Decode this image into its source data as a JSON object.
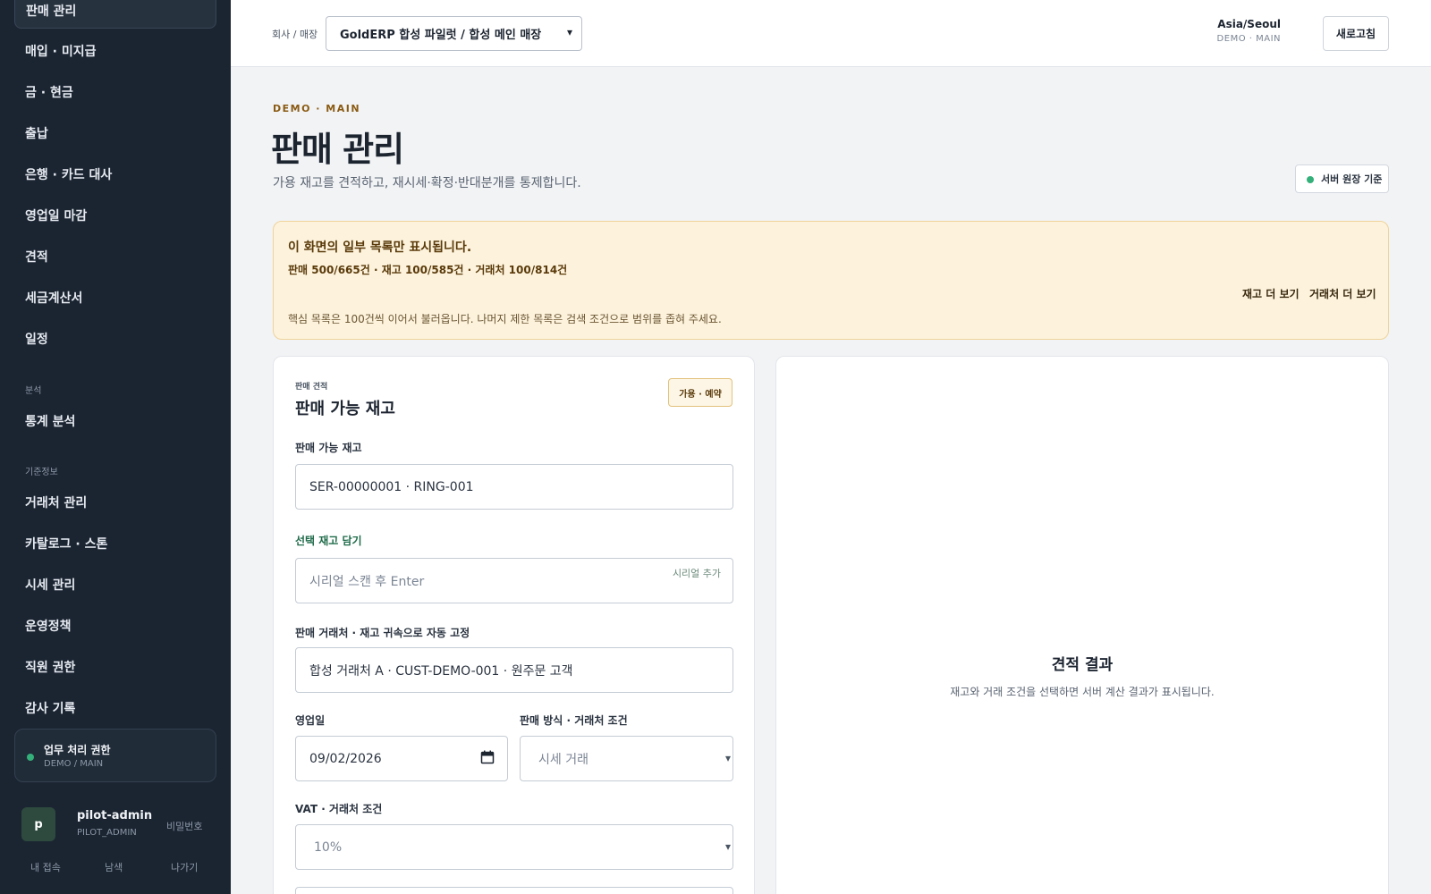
{
  "sidebar": {
    "items": [
      {
        "label": "판매 관리"
      },
      {
        "label": "매입 · 미지급"
      },
      {
        "label": "금 · 현금"
      },
      {
        "label": "출납"
      },
      {
        "label": "은행 · 카드 대사"
      },
      {
        "label": "영업일 마감"
      },
      {
        "label": "견적"
      },
      {
        "label": "세금계산서"
      },
      {
        "label": "일정"
      }
    ],
    "analysis_section": "분석",
    "analysis_items": [
      {
        "label": "통계 분석"
      }
    ],
    "master_section": "기준정보",
    "master_items": [
      {
        "label": "거래처 관리"
      },
      {
        "label": "카탈로그 · 스톤"
      },
      {
        "label": "시세 관리"
      },
      {
        "label": "운영정책"
      },
      {
        "label": "직원 권한"
      },
      {
        "label": "감사 기록"
      }
    ],
    "permission": {
      "title": "업무 처리 권한",
      "scope": "DEMO / MAIN"
    },
    "user": {
      "initial": "p",
      "name": "pilot-admin",
      "role": "PILOT_ADMIN",
      "password_link": "비밀번호"
    },
    "footer_links": [
      "내 접속",
      "남색",
      "나가기"
    ]
  },
  "topbar": {
    "company_label": "회사 / 매장",
    "company_value": "GoldERP 합성 파일럿 / 합성 메인 매장",
    "timezone": "Asia/Seoul",
    "timezone_sub": "DEMO · MAIN",
    "refresh_label": "새로고침"
  },
  "header": {
    "eyebrow": "DEMO · MAIN",
    "title": "판매 관리",
    "description": "가용 재고를 견적하고, 재시세·확정·반대분개를 통제합니다.",
    "server_badge": "서버 원장 기준"
  },
  "notice": {
    "title": "이 화면의 일부 목록만 표시됩니다.",
    "stats": "판매 500/665건 · 재고 100/585건 · 거래처 100/814건",
    "more_inventory": "재고 더 보기",
    "more_customers": "거래처 더 보기",
    "note": "핵심 목록은 100건씩 이어서 불러옵니다. 나머지 제한 목록은 검색 조건으로 범위를 좁혀 주세요."
  },
  "quote_form": {
    "eyebrow": "판매 견적",
    "title": "판매 가능 재고",
    "badge": "가용 · 예약",
    "inventory_label": "판매 가능 재고",
    "inventory_value": "SER-00000001 · RING-001",
    "cart_label": "선택 재고 담기",
    "serial_placeholder": "시리얼 스캔 후 Enter",
    "serial_add": "시리얼 추가",
    "customer_label": "판매 거래처 · 재고 귀속으로 자동 고정",
    "customer_value": "합성 거래처 A · CUST-DEMO-001 · 원주문 고객",
    "date_label": "영업일",
    "date_value": "09/02/2026",
    "method_label": "판매 방식 · 거래처 조건",
    "method_value": "시세 거래",
    "vat_label": "VAT · 거래처 조건",
    "vat_value": "10%"
  },
  "result": {
    "title": "견적 결과",
    "description": "재고와 거래 조건을 선택하면 서버 계산 결과가 표시됩니다."
  }
}
